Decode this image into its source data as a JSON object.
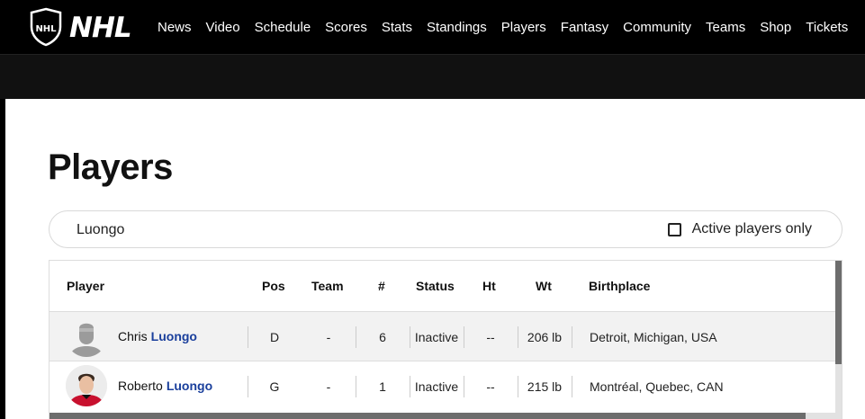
{
  "brand": {
    "wordmark": "NHL"
  },
  "nav": {
    "items": [
      "News",
      "Video",
      "Schedule",
      "Scores",
      "Stats",
      "Standings",
      "Players",
      "Fantasy",
      "Community",
      "Teams",
      "Shop",
      "Tickets"
    ]
  },
  "page": {
    "title": "Players"
  },
  "search": {
    "value": "Luongo",
    "active_only_label": "Active players only",
    "active_only_checked": false
  },
  "table": {
    "columns": [
      "Player",
      "Pos",
      "Team",
      "#",
      "Status",
      "Ht",
      "Wt",
      "Birthplace"
    ],
    "rows": [
      {
        "first": "Chris",
        "last": "Luongo",
        "avatar": "silhouette-icon",
        "pos": "D",
        "team": "-",
        "number": "6",
        "status": "Inactive",
        "ht": "--",
        "wt": "206 lb",
        "birthplace": "Detroit, Michigan, USA"
      },
      {
        "first": "Roberto",
        "last": "Luongo",
        "avatar": "headshot-photo",
        "pos": "G",
        "team": "-",
        "number": "1",
        "status": "Inactive",
        "ht": "--",
        "wt": "215 lb",
        "birthplace": "Montréal, Quebec, CAN"
      }
    ]
  },
  "colors": {
    "accent_link": "#1a3f9c",
    "nav_bg": "#000000"
  }
}
